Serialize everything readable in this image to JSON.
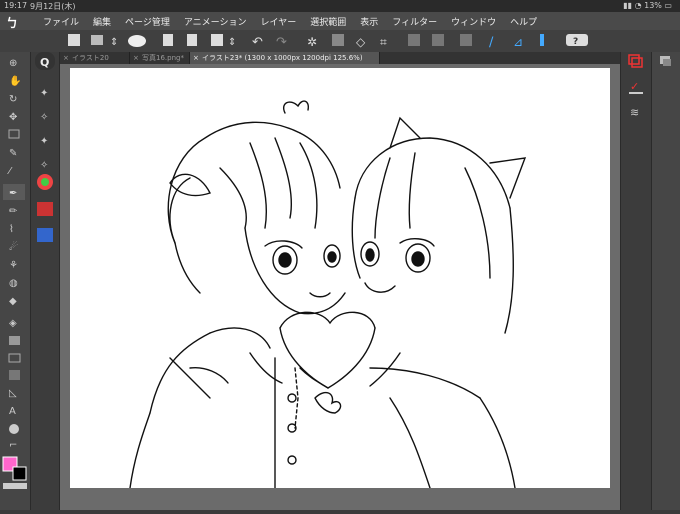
{
  "status": {
    "time": "19:17",
    "date": "9月12日(木)",
    "battery": "13%"
  },
  "menu": [
    "ファイル",
    "編集",
    "ページ管理",
    "アニメーション",
    "レイヤー",
    "選択範囲",
    "表示",
    "フィルター",
    "ウィンドウ",
    "ヘルプ"
  ],
  "tabs": [
    {
      "label": "イラスト20"
    },
    {
      "label": "写真16.png*"
    },
    {
      "label": "イラスト23* (1300 x 1000px 1200dpi 125.6%)"
    }
  ],
  "colors": {
    "main": "#ff66cc",
    "sub": "#000000"
  },
  "icons": {
    "left_tools": [
      "magnify-icon",
      "hand-icon",
      "rotate-icon",
      "move-icon",
      "select-icon",
      "lasso-icon",
      "eyedropper-icon",
      "pen-icon",
      "pencil-icon",
      "brush-icon",
      "airbrush-icon",
      "blend-icon",
      "eraser-icon",
      "fill-icon",
      "gradient-icon",
      "figure-icon",
      "frame-icon",
      "ruler-icon",
      "text-icon",
      "balloon-icon",
      "line-correction-icon"
    ],
    "right_panel": [
      "layer-icon",
      "property-icon",
      "sub-tool-icon"
    ]
  }
}
